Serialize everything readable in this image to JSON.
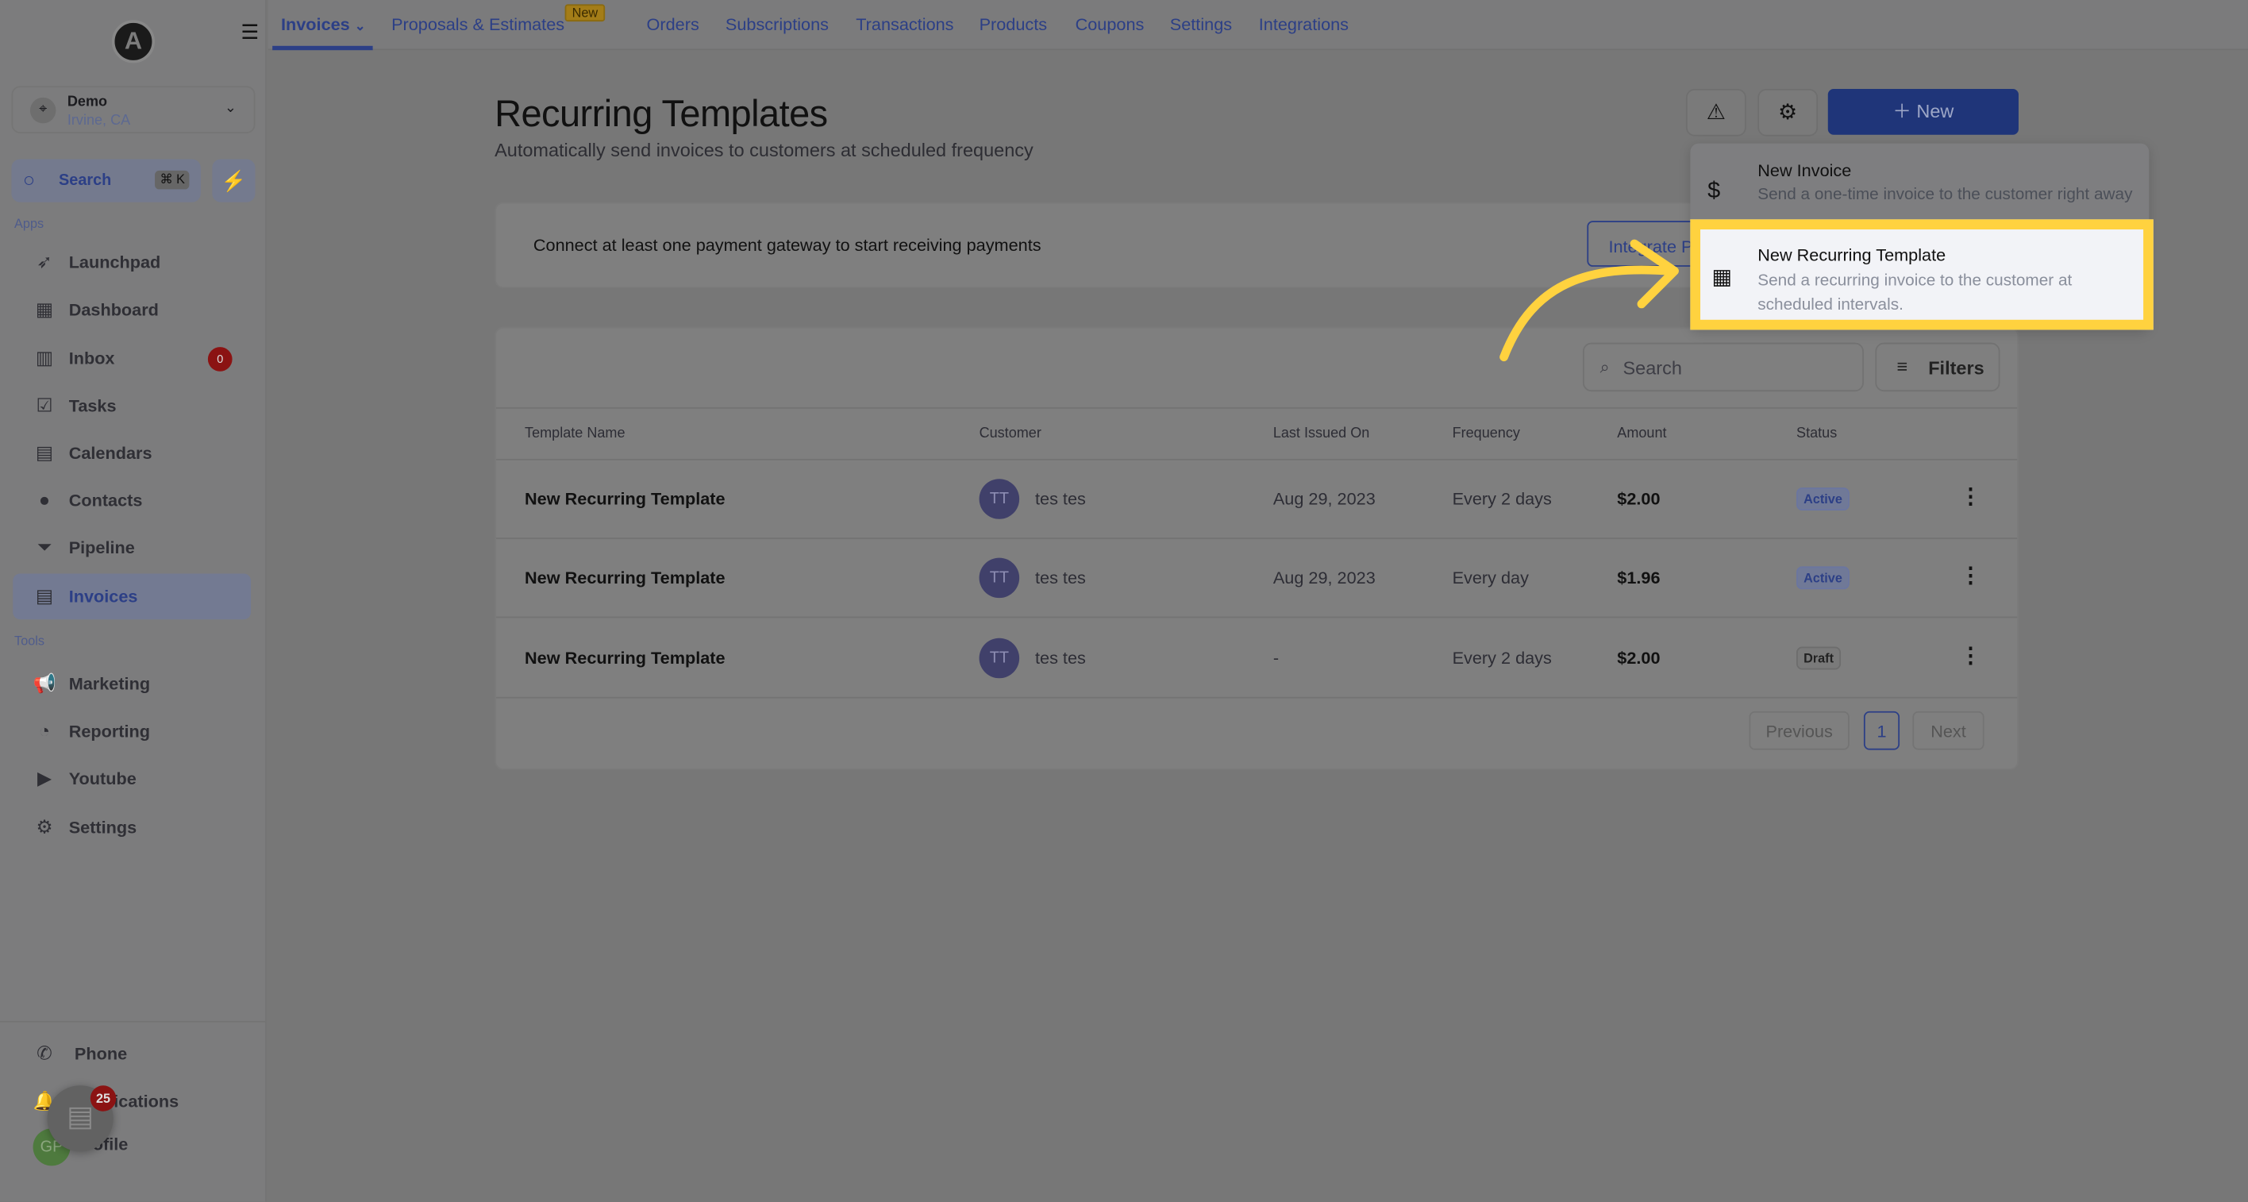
{
  "sidebar": {
    "location": {
      "name": "Demo",
      "city": "Irvine, CA"
    },
    "search": {
      "label": "Search",
      "shortcut": "⌘ K"
    },
    "apps_label": "Apps",
    "tools_label": "Tools",
    "apps": [
      {
        "label": "Launchpad",
        "icon": "rocket-icon"
      },
      {
        "label": "Dashboard",
        "icon": "dashboard-icon"
      },
      {
        "label": "Inbox",
        "icon": "inbox-icon",
        "badge": "0"
      },
      {
        "label": "Tasks",
        "icon": "tasks-icon"
      },
      {
        "label": "Calendars",
        "icon": "calendar-icon"
      },
      {
        "label": "Contacts",
        "icon": "contacts-icon"
      },
      {
        "label": "Pipeline",
        "icon": "pipeline-icon"
      },
      {
        "label": "Invoices",
        "icon": "invoice-icon",
        "active": true
      }
    ],
    "tools": [
      {
        "label": "Marketing",
        "icon": "megaphone-icon"
      },
      {
        "label": "Reporting",
        "icon": "chart-icon"
      },
      {
        "label": "Youtube",
        "icon": "youtube-icon"
      },
      {
        "label": "Settings",
        "icon": "gear-icon"
      }
    ],
    "bottom": [
      {
        "label": "Phone"
      },
      {
        "label": "Notifications"
      },
      {
        "label": "Profile"
      }
    ],
    "chat_badge": "25",
    "avatar": "GP"
  },
  "topnav": {
    "tabs": [
      "Invoices",
      "Proposals & Estimates",
      "Orders",
      "Subscriptions",
      "Transactions",
      "Products",
      "Coupons",
      "Settings",
      "Integrations"
    ],
    "new_tag": "New"
  },
  "header": {
    "title": "Recurring Templates",
    "subtitle": "Automatically send invoices to customers at scheduled frequency",
    "new_button": "New"
  },
  "alert": {
    "text": "Connect at least one payment gateway to start receiving payments",
    "button": "Integrate Payment"
  },
  "dropdown": {
    "items": [
      {
        "title": "New Invoice",
        "desc": "Send a one-time invoice to the customer right away"
      },
      {
        "title": "New Recurring Template",
        "desc": "Send a recurring invoice to the customer at scheduled intervals."
      }
    ]
  },
  "table": {
    "search_placeholder": "Search",
    "filters": "Filters",
    "columns": [
      "Template Name",
      "Customer",
      "Last Issued On",
      "Frequency",
      "Amount",
      "Status"
    ],
    "rows": [
      {
        "name": "New Recurring Template",
        "initials": "TT",
        "customer": "tes tes",
        "last": "Aug 29, 2023",
        "freq": "Every 2 days",
        "amount": "$2.00",
        "status": "Active"
      },
      {
        "name": "New Recurring Template",
        "initials": "TT",
        "customer": "tes tes",
        "last": "Aug 29, 2023",
        "freq": "Every day",
        "amount": "$1.96",
        "status": "Active"
      },
      {
        "name": "New Recurring Template",
        "initials": "TT",
        "customer": "tes tes",
        "last": "-",
        "freq": "Every 2 days",
        "amount": "$2.00",
        "status": "Draft"
      }
    ],
    "pagination": {
      "previous": "Previous",
      "page": "1",
      "next": "Next"
    }
  },
  "colors": {
    "highlight": "#ffd23f",
    "primary": "#1f3579",
    "annotation_arrow": "#ffd23f"
  }
}
